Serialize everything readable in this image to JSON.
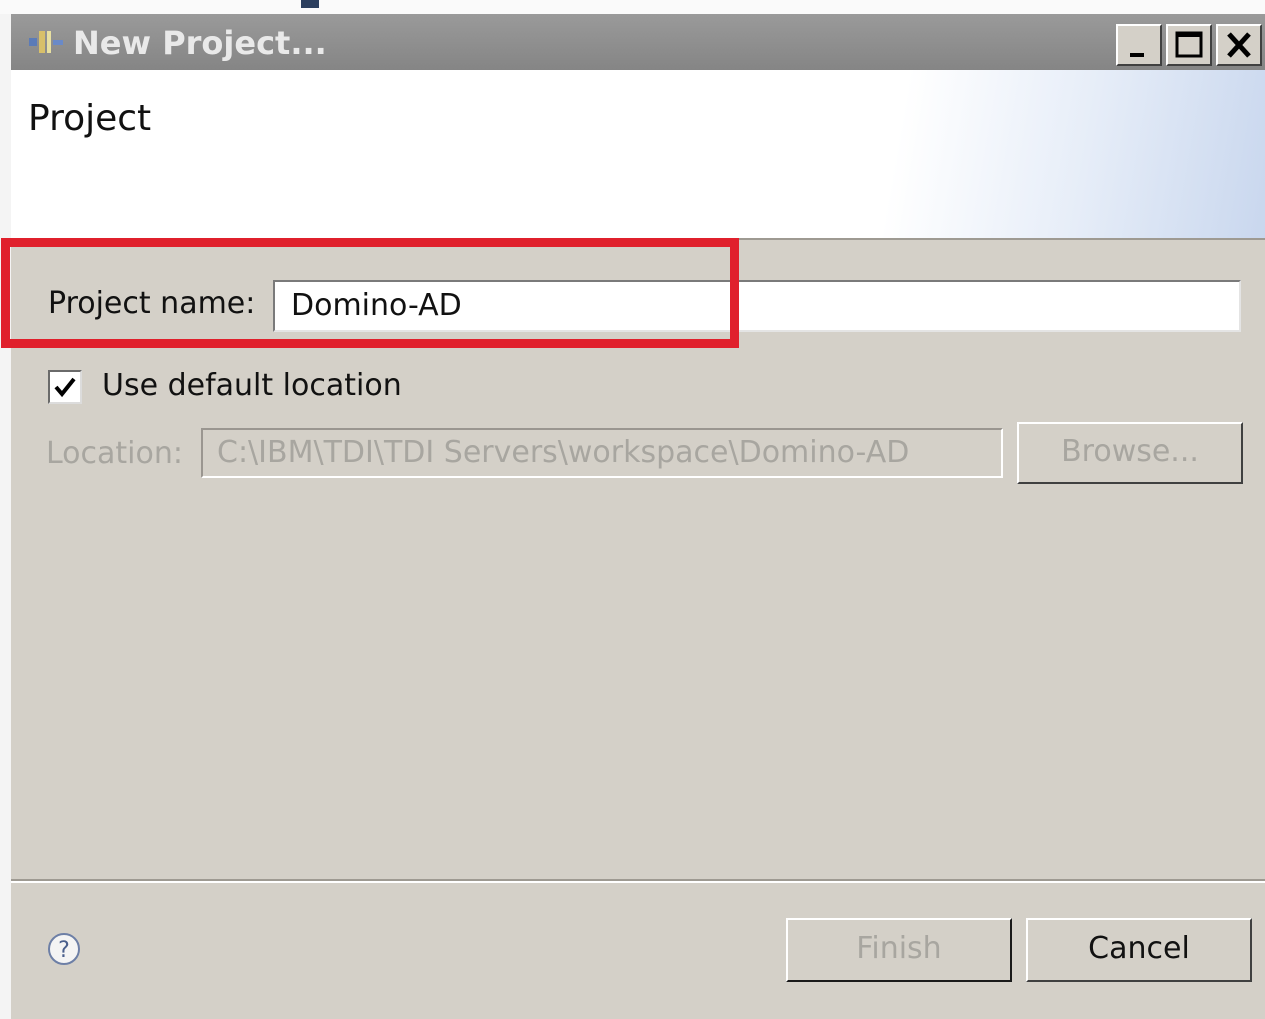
{
  "window": {
    "title": "New Project..."
  },
  "header": {
    "title": "Project"
  },
  "form": {
    "project_name_label": "Project name:",
    "project_name_value": "Domino-AD",
    "use_default_location_label": "Use default location",
    "use_default_location_checked": true,
    "location_label": "Location:",
    "location_value": "C:\\IBM\\TDI\\TDI Servers\\workspace\\Domino-AD",
    "browse_label": "Browse..."
  },
  "footer": {
    "finish_label": "Finish",
    "cancel_label": "Cancel"
  },
  "icons": {
    "app": "eclipse-project-icon",
    "minimize": "minimize-icon",
    "maximize": "maximize-icon",
    "close": "close-icon",
    "help": "help-icon",
    "check": "checkmark-icon"
  },
  "colors": {
    "highlight": "#e0202c",
    "dialog_background": "#d4d0c8",
    "titlebar": "#8f8f8f",
    "disabled_text": "#a8a6a0"
  }
}
